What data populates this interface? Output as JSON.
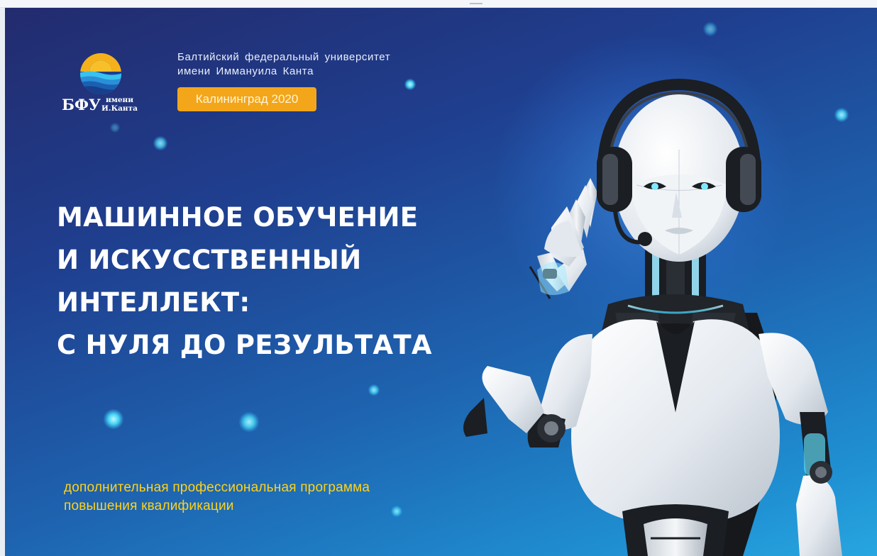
{
  "slide": {
    "university_lines": [
      "Балтийский федеральный университет",
      "имени Иммануила Канта"
    ],
    "logo": {
      "abbr": "БФУ",
      "sub_lines": [
        "имени",
        "И.Канта"
      ],
      "icon": "sun-over-waves-icon",
      "colors": {
        "sun": "#f5b11c",
        "wave_light": "#39c2ee",
        "wave_dark": "#1b5fb3"
      }
    },
    "city_badge": "Калининград 2020",
    "title_lines": [
      "МАШИННОЕ ОБУЧЕНИЕ",
      "И ИСКУССТВЕННЫЙ",
      "ИНТЕЛЛЕКТ:",
      "С НУЛЯ ДО РЕЗУЛЬТАТА"
    ],
    "subtitle_lines": [
      "дополнительная профессиональная программа",
      "повышения квалификации"
    ],
    "illustration": "robot-with-headset-icon",
    "colors": {
      "background_top": "#232b6e",
      "background_bottom": "#27a6e0",
      "badge": "#f3a61a",
      "subtitle": "#ffd21a",
      "title": "#ffffff"
    }
  }
}
